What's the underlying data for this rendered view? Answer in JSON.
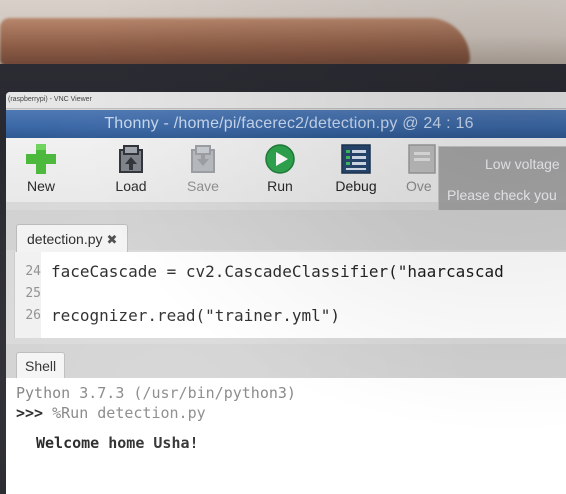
{
  "vnc_title": "(raspberrypi) - VNC Viewer",
  "window": {
    "title": "Thonny  -  /home/pi/facerec2/detection.py  @  24 : 16"
  },
  "toolbar": {
    "new": "New",
    "load": "Load",
    "save": "Save",
    "run": "Run",
    "debug": "Debug",
    "over": "Ove"
  },
  "notification": {
    "line1": "Low voltage",
    "line2": "Please check you"
  },
  "editor": {
    "tab": "detection.py",
    "lines": [
      {
        "no": "24",
        "code": "faceCascade = cv2.CascadeClassifier(\"haarcascad"
      },
      {
        "no": "25",
        "code": ""
      },
      {
        "no": "26",
        "code": "recognizer.read(\"trainer.yml\")"
      }
    ]
  },
  "shell": {
    "tab": "Shell",
    "version": "Python 3.7.3 (/usr/bin/python3)",
    "prompt": ">>>",
    "command": " %Run detection.py",
    "output": "Welcome home Usha!"
  },
  "colors": {
    "title_bar": "#3b68a6",
    "run_icon": "#2aa34a",
    "new_icon": "#49b83a"
  }
}
